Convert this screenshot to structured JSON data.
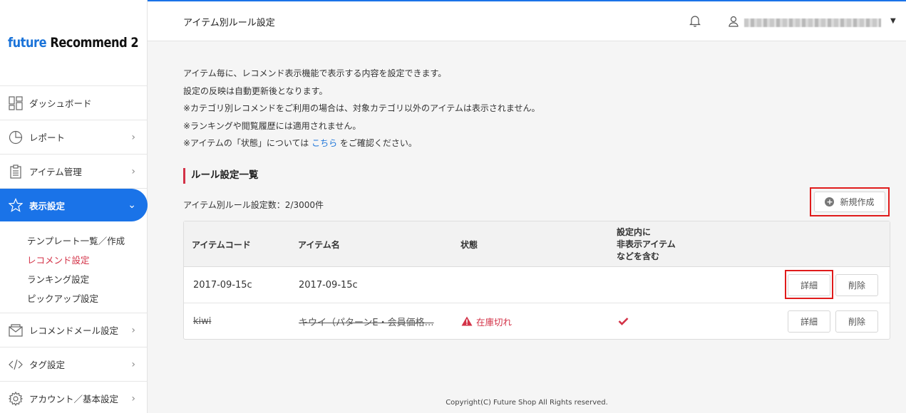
{
  "app": {
    "logo_part1": "future",
    "logo_part2": " Recommend 2"
  },
  "sidebar": {
    "items": [
      {
        "label": "ダッシュボード"
      },
      {
        "label": "レポート"
      },
      {
        "label": "アイテム管理"
      },
      {
        "label": "表示設定"
      },
      {
        "label": "レコメンドメール設定"
      },
      {
        "label": "タグ設定"
      },
      {
        "label": "アカウント／基本設定"
      }
    ],
    "submenu": [
      {
        "label": "テンプレート一覧／作成"
      },
      {
        "label": "レコメンド設定"
      },
      {
        "label": "ランキング設定"
      },
      {
        "label": "ピックアップ設定"
      }
    ]
  },
  "header": {
    "title": "アイテム別ルール設定"
  },
  "description": {
    "line1": "アイテム毎に、レコメンド表示機能で表示する内容を設定できます。",
    "line2": "設定の反映は自動更新後となります。",
    "line3": "※カテゴリ別レコメンドをご利用の場合は、対象カテゴリ以外のアイテムは表示されません。",
    "line4": "※ランキングや閲覧履歴には適用されません。",
    "line5_before": "※アイテムの「状態」については ",
    "line5_link": "こちら",
    "line5_after": " をご確認ください。"
  },
  "section": {
    "title": "ルール設定一覧",
    "count_label": "アイテム別ルール設定数：2/3000件",
    "new_button": "新規作成"
  },
  "table": {
    "headers": {
      "code": "アイテムコード",
      "name": "アイテム名",
      "status": "状態",
      "hidden_line1": "設定内に",
      "hidden_line2": "非表示アイテム",
      "hidden_line3": "などを含む"
    },
    "rows": [
      {
        "code": "2017-09-15c",
        "name": "2017-09-15c",
        "status": "",
        "detail": "詳細",
        "delete": "削除"
      },
      {
        "code": "kiwi",
        "name": "キウイ（パターンE・会員価格…",
        "status": "在庫切れ",
        "detail": "詳細",
        "delete": "削除"
      }
    ]
  },
  "footer": {
    "copyright": "Copyright(C) Future Shop All Rights reserved."
  },
  "colors": {
    "accent": "#1a73e8",
    "danger": "#d33247",
    "highlight": "#e01b1b"
  },
  "icons": [
    "dashboard-icon",
    "pie-chart-icon",
    "clipboard-icon",
    "star-icon",
    "mail-icon",
    "code-icon",
    "gear-icon",
    "bell-icon",
    "user-icon",
    "warning-icon",
    "check-icon",
    "plus-circle-icon"
  ]
}
